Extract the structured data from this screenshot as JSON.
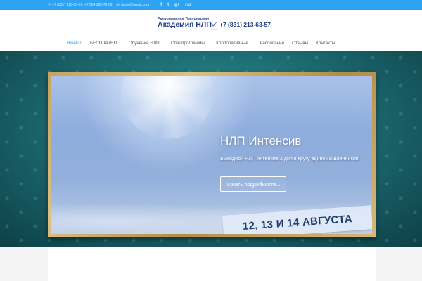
{
  "topbar": {
    "phones": "+7 (831) 213-63-57, +7 904 395-79-59",
    "email": "rtanlp@gmail.com",
    "social": [
      "f",
      "t",
      "g+",
      "rss"
    ]
  },
  "logo": {
    "small": "Региональная Тренинговая",
    "big": "Академия НЛП",
    "phone": "+7 (831) 213-63-57",
    "caption": "ртанлп"
  },
  "nav": {
    "items": [
      {
        "label": "Начало",
        "active": true,
        "dropdown": false
      },
      {
        "label": "БЕСПЛАТНО",
        "active": false,
        "dropdown": true
      },
      {
        "label": "Обучение НЛП",
        "active": false,
        "dropdown": true
      },
      {
        "label": "Спецпрограммы",
        "active": false,
        "dropdown": true
      },
      {
        "label": "Корпоративные",
        "active": false,
        "dropdown": true
      },
      {
        "label": "Расписание",
        "active": false,
        "dropdown": false
      },
      {
        "label": "Отзывы",
        "active": false,
        "dropdown": false
      },
      {
        "label": "Контакты",
        "active": false,
        "dropdown": true
      }
    ]
  },
  "slide": {
    "title": "НЛП Интенсив",
    "subtitle": "Выездной НЛП интенсив 3 дня в кругу единомышленников!",
    "button": "Узнать подробности...",
    "banner": "12, 13 И 14 АВГУСТА",
    "dots_total": 14,
    "dots_active": 0
  },
  "colors": {
    "accent": "#2ea3f2",
    "logo_blue": "#1e3f86",
    "frame_wood": "#c7a35f"
  }
}
